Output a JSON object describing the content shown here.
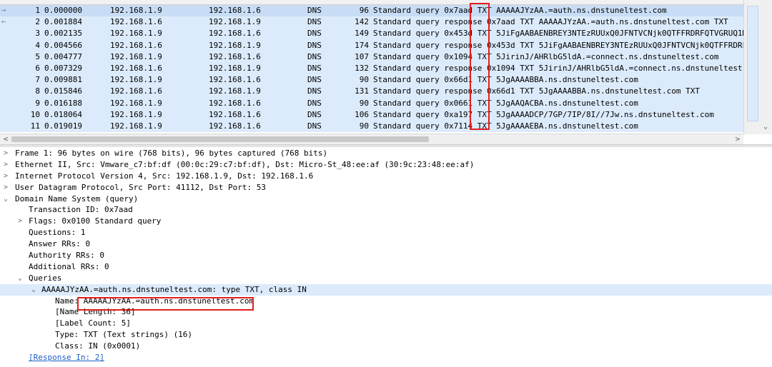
{
  "packet_list": {
    "rows": [
      {
        "marker": "→",
        "no": "1",
        "time": "0.000000",
        "source": "192.168.1.9",
        "destination": "192.168.1.6",
        "protocol": "DNS",
        "length": "96",
        "info": "Standard query 0x7aad TXT AAAAAJYzAA.=auth.ns.dnstuneltest.com"
      },
      {
        "marker": "←",
        "no": "2",
        "time": "0.001884",
        "source": "192.168.1.6",
        "destination": "192.168.1.9",
        "protocol": "DNS",
        "length": "142",
        "info": "Standard query response 0x7aad TXT AAAAAJYzAA.=auth.ns.dnstuneltest.com TXT"
      },
      {
        "marker": "",
        "no": "3",
        "time": "0.002135",
        "source": "192.168.1.9",
        "destination": "192.168.1.6",
        "protocol": "DNS",
        "length": "149",
        "info": "Standard query 0x453d TXT 5JiFgAABAENBREY3NTEzRUUxQ0JFNTVCNjk0QTFFRDRFQTVGRUQ1ME"
      },
      {
        "marker": "",
        "no": "4",
        "time": "0.004566",
        "source": "192.168.1.6",
        "destination": "192.168.1.9",
        "protocol": "DNS",
        "length": "174",
        "info": "Standard query response 0x453d TXT 5JiFgAABAENBREY3NTEzRUUxQ0JFNTVCNjk0QTFFRDRFQ"
      },
      {
        "marker": "",
        "no": "5",
        "time": "0.004777",
        "source": "192.168.1.9",
        "destination": "192.168.1.6",
        "protocol": "DNS",
        "length": "107",
        "info": "Standard query 0x1094 TXT 5JirinJ/AHRlbG5ldA.=connect.ns.dnstuneltest.com"
      },
      {
        "marker": "",
        "no": "6",
        "time": "0.007329",
        "source": "192.168.1.6",
        "destination": "192.168.1.9",
        "protocol": "DNS",
        "length": "132",
        "info": "Standard query response 0x1094 TXT 5JirinJ/AHRlbG5ldA.=connect.ns.dnstuneltest.c"
      },
      {
        "marker": "",
        "no": "7",
        "time": "0.009881",
        "source": "192.168.1.9",
        "destination": "192.168.1.6",
        "protocol": "DNS",
        "length": "90",
        "info": "Standard query 0x66d1 TXT 5JgAAAABBA.ns.dnstuneltest.com"
      },
      {
        "marker": "",
        "no": "8",
        "time": "0.015846",
        "source": "192.168.1.6",
        "destination": "192.168.1.9",
        "protocol": "DNS",
        "length": "131",
        "info": "Standard query response 0x66d1 TXT 5JgAAAABBA.ns.dnstuneltest.com TXT"
      },
      {
        "marker": "",
        "no": "9",
        "time": "0.016188",
        "source": "192.168.1.9",
        "destination": "192.168.1.6",
        "protocol": "DNS",
        "length": "90",
        "info": "Standard query 0x0661 TXT 5JgAAQACBA.ns.dnstuneltest.com"
      },
      {
        "marker": "",
        "no": "10",
        "time": "0.018064",
        "source": "192.168.1.9",
        "destination": "192.168.1.6",
        "protocol": "DNS",
        "length": "106",
        "info": "Standard query 0xa197 TXT 5JgAAAADCP/7GP/7IP/8I//7Jw.ns.dnstuneltest.com"
      },
      {
        "marker": "",
        "no": "11",
        "time": "0.019019",
        "source": "192.168.1.9",
        "destination": "192.168.1.6",
        "protocol": "DNS",
        "length": "90",
        "info": "Standard query 0x7114 TXT 5JgAAAAEBA.ns.dnstuneltest.com"
      }
    ]
  },
  "details": {
    "lines": [
      {
        "arrow": ">",
        "text": "Frame 1: 96 bytes on wire (768 bits), 96 bytes captured (768 bits)"
      },
      {
        "arrow": ">",
        "text": "Ethernet II, Src: Vmware_c7:bf:df (00:0c:29:c7:bf:df), Dst: Micro-St_48:ee:af (30:9c:23:48:ee:af)"
      },
      {
        "arrow": ">",
        "text": "Internet Protocol Version 4, Src: 192.168.1.9, Dst: 192.168.1.6"
      },
      {
        "arrow": ">",
        "text": "User Datagram Protocol, Src Port: 41112, Dst Port: 53"
      },
      {
        "arrow": "⌄",
        "text": "Domain Name System (query)"
      },
      {
        "arrow": "",
        "text": "Transaction ID: 0x7aad"
      },
      {
        "arrow": ">",
        "text": "Flags: 0x0100 Standard query"
      },
      {
        "arrow": "",
        "text": "Questions: 1"
      },
      {
        "arrow": "",
        "text": "Answer RRs: 0"
      },
      {
        "arrow": "",
        "text": "Authority RRs: 0"
      },
      {
        "arrow": "",
        "text": "Additional RRs: 0"
      },
      {
        "arrow": "⌄",
        "text": "Queries"
      },
      {
        "arrow": "⌄",
        "text": "AAAAAJYzAA.=auth.ns.dnstuneltest.com: type TXT, class IN"
      },
      {
        "arrow": "",
        "text": "Name: AAAAAJYzAA.=auth.ns.dnstuneltest.com"
      },
      {
        "arrow": "",
        "text": "[Name Length: 36]"
      },
      {
        "arrow": "",
        "text": "[Label Count: 5]"
      },
      {
        "arrow": "",
        "text": "Type: TXT (Text strings) (16)"
      },
      {
        "arrow": "",
        "text": "Class: IN (0x0001)"
      },
      {
        "arrow": "",
        "text": "[Response In: 2]"
      }
    ]
  },
  "scrollbar": {
    "left_arrow": "<",
    "right_arrow": ">",
    "down_arrow": "⌄"
  },
  "colors": {
    "row_bg": "#dcebfb",
    "highlight_border": "#e0201e",
    "link": "#1a5fc8"
  }
}
